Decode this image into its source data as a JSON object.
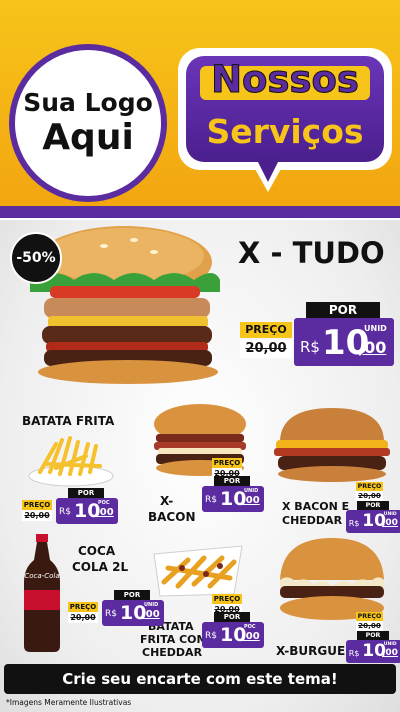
{
  "header": {
    "logo_line1": "Sua Logo",
    "logo_line2": "Aqui",
    "title_line1": "Nossos",
    "title_line2": "Serviços"
  },
  "colors": {
    "yellow": "#f7c419",
    "purple": "#5b2ca0",
    "black": "#111111"
  },
  "featured": {
    "name": "X - TUDO",
    "discount": "-50%",
    "preco_label": "PREÇO",
    "old_price": "20,00",
    "por_label": "POR",
    "currency": "R$",
    "price_int": "10",
    "price_dec": ",00",
    "unit": "UNID"
  },
  "items": [
    {
      "name_l1": "BATATA FRITA",
      "name_l2": "",
      "preco_label": "PREÇO",
      "old_price": "20,00",
      "por_label": "POR",
      "currency": "R$",
      "price_int": "10",
      "price_dec": ",00",
      "unit": "POC"
    },
    {
      "name_l1": "X-",
      "name_l2": "BACON",
      "preco_label": "PREÇO",
      "old_price": "20,00",
      "por_label": "POR",
      "currency": "R$",
      "price_int": "10",
      "price_dec": ",00",
      "unit": "UNID"
    },
    {
      "name_l1": "X BACON E",
      "name_l2": "CHEDDAR",
      "preco_label": "PREÇO",
      "old_price": "20,00",
      "por_label": "POR",
      "currency": "R$",
      "price_int": "10",
      "price_dec": ",00",
      "unit": "UNID"
    },
    {
      "name_l1": "COCA",
      "name_l2": "COLA 2L",
      "preco_label": "PREÇO",
      "old_price": "20,00",
      "por_label": "POR",
      "currency": "R$",
      "price_int": "10",
      "price_dec": ",00",
      "unit": "UNID"
    },
    {
      "name_l1": "BATATA",
      "name_l2": "FRITA COM",
      "name_l3": "CHEDDAR",
      "preco_label": "PREÇO",
      "old_price": "20,00",
      "por_label": "POR",
      "currency": "R$",
      "price_int": "10",
      "price_dec": ",00",
      "unit": "POC"
    },
    {
      "name_l1": "X-BURGUER",
      "name_l2": "",
      "preco_label": "PREÇO",
      "old_price": "20,00",
      "por_label": "POR",
      "currency": "R$",
      "price_int": "10",
      "price_dec": ",00",
      "unit": "UNID"
    }
  ],
  "coke_label": "Coca-Cola",
  "cta": "Crie seu encarte com este tema!",
  "disclaimer": "*Imagens Meramente Ilustrativas"
}
